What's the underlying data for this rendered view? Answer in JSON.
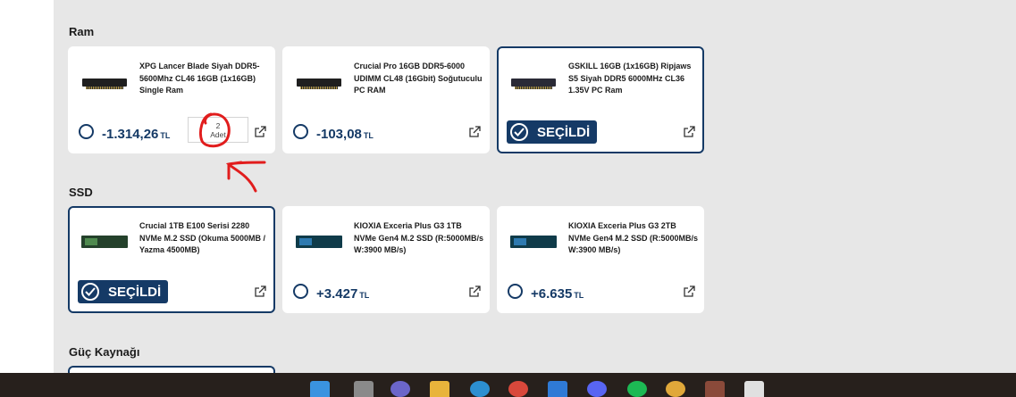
{
  "sections": {
    "ram_title": "Ram",
    "ssd_title": "SSD",
    "psu_title": "Güç Kaynağı"
  },
  "ram": [
    {
      "name": "XPG Lancer Blade Siyah DDR5-5600Mhz CL46 16GB (1x16GB) Single Ram",
      "price": "-1.314,26",
      "currency": "TL",
      "qty_value": "2",
      "qty_unit": "Adet"
    },
    {
      "name": "Crucial Pro 16GB DDR5-6000 UDIMM CL48 (16Gbit) Soğutuculu PC RAM",
      "price": "-103,08",
      "currency": "TL"
    },
    {
      "name": "GSKILL 16GB (1x16GB) Ripjaws S5 Siyah DDR5 6000MHz CL36 1.35V PC Ram",
      "selected_label": "SEÇİLDİ"
    }
  ],
  "ssd": [
    {
      "name": "Crucial 1TB E100 Serisi 2280 NVMe M.2 SSD (Okuma 5000MB / Yazma 4500MB)",
      "selected_label": "SEÇİLDİ"
    },
    {
      "name": "KIOXIA Exceria Plus G3 1TB NVMe Gen4 M.2 SSD (R:5000MB/s W:3900 MB/s)",
      "price": "+3.427",
      "currency": "TL"
    },
    {
      "name": "KIOXIA Exceria Plus G3 2TB NVMe Gen4 M.2 SSD (R:5000MB/s W:3900 MB/s)",
      "price": "+6.635",
      "currency": "TL"
    }
  ],
  "colors": {
    "accent": "#153a66",
    "background": "#e7e7e7",
    "annotation": "#e11d1d",
    "taskbar": "#27201c"
  },
  "icons": {
    "external": "external-link-icon",
    "check": "check-circle-icon",
    "radio": "radio-unselected-icon"
  }
}
